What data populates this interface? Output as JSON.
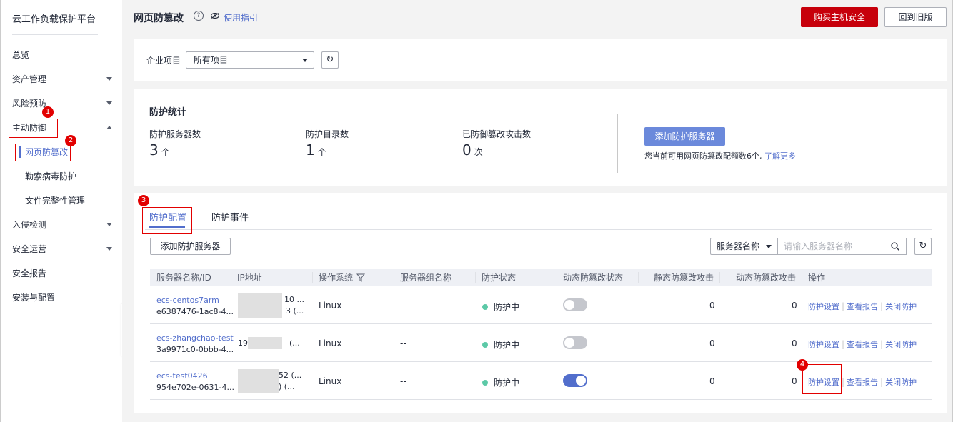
{
  "sidebar": {
    "title": "云工作负载保护平台",
    "items": [
      {
        "label": "总览"
      },
      {
        "label": "资产管理"
      },
      {
        "label": "风险预防"
      },
      {
        "label": "主动防御"
      },
      {
        "label": "网页防篡改"
      },
      {
        "label": "勒索病毒防护"
      },
      {
        "label": "文件完整性管理"
      },
      {
        "label": "入侵检测"
      },
      {
        "label": "安全运营"
      },
      {
        "label": "安全报告"
      },
      {
        "label": "安装与配置"
      }
    ]
  },
  "header": {
    "title": "网页防篡改",
    "help_icon": "?",
    "guide_link": "使用指引",
    "buy_button": "购买主机安全",
    "old_version_button": "回到旧版"
  },
  "project": {
    "label": "企业项目",
    "selected": "所有项目",
    "refresh_icon": "↻"
  },
  "stats": {
    "title": "防护统计",
    "servers_label": "防护服务器数",
    "servers_value": "3",
    "servers_unit": "个",
    "dirs_label": "防护目录数",
    "dirs_value": "1",
    "dirs_unit": "个",
    "attacks_label": "已防御篡改攻击数",
    "attacks_value": "0",
    "attacks_unit": "次",
    "add_button": "添加防护服务器",
    "quota_text": "您当前可用网页防篡改配额数6个,",
    "learn_more": "了解更多"
  },
  "tabs": [
    {
      "label": "防护配置"
    },
    {
      "label": "防护事件"
    }
  ],
  "toolbar": {
    "add_button": "添加防护服务器",
    "filter_selected": "服务器名称",
    "search_placeholder": "请输入服务器名称"
  },
  "table": {
    "columns": [
      "服务器名称/ID",
      "IP地址",
      "操作系统",
      "服务器组名称",
      "防护状态",
      "动态防篡改状态",
      "静态防篡改攻击",
      "动态防篡改攻击",
      "操作"
    ],
    "rows": [
      {
        "name": "ecs-centos7arm",
        "id": "e6387476-1ac8-4...",
        "ip1": "10 ...",
        "ip2": "3 (...",
        "os": "Linux",
        "group": "--",
        "status": "防护中",
        "dynamic_on": false,
        "static_attacks": "0",
        "dynamic_attacks": "0",
        "op1": "防护设置",
        "op2": "查看报告",
        "op3": "关闭防护"
      },
      {
        "name": "ecs-zhangchao-test",
        "id": "3a9971c0-0bbb-4...",
        "ip1": "19",
        "ip2": "(...",
        "os": "Linux",
        "group": "--",
        "status": "防护中",
        "dynamic_on": false,
        "static_attacks": "0",
        "dynamic_attacks": "0",
        "op1": "防护设置",
        "op2": "查看报告",
        "op3": "关闭防护"
      },
      {
        "name": "ecs-test0426",
        "id": "954e702e-0631-4...",
        "ip1": "52 (...",
        "ip2": ") (...",
        "os": "Linux",
        "group": "--",
        "status": "防护中",
        "dynamic_on": true,
        "static_attacks": "0",
        "dynamic_attacks": "0",
        "op1": "防护设置",
        "op2": "查看报告",
        "op3": "关闭防护"
      }
    ]
  },
  "annotations": [
    "1",
    "2",
    "3",
    "4"
  ],
  "colors": {
    "accent": "#526ecc",
    "brand_red": "#c7000b",
    "status_green": "#5cc9a7",
    "annotation_red": "#e20000"
  }
}
